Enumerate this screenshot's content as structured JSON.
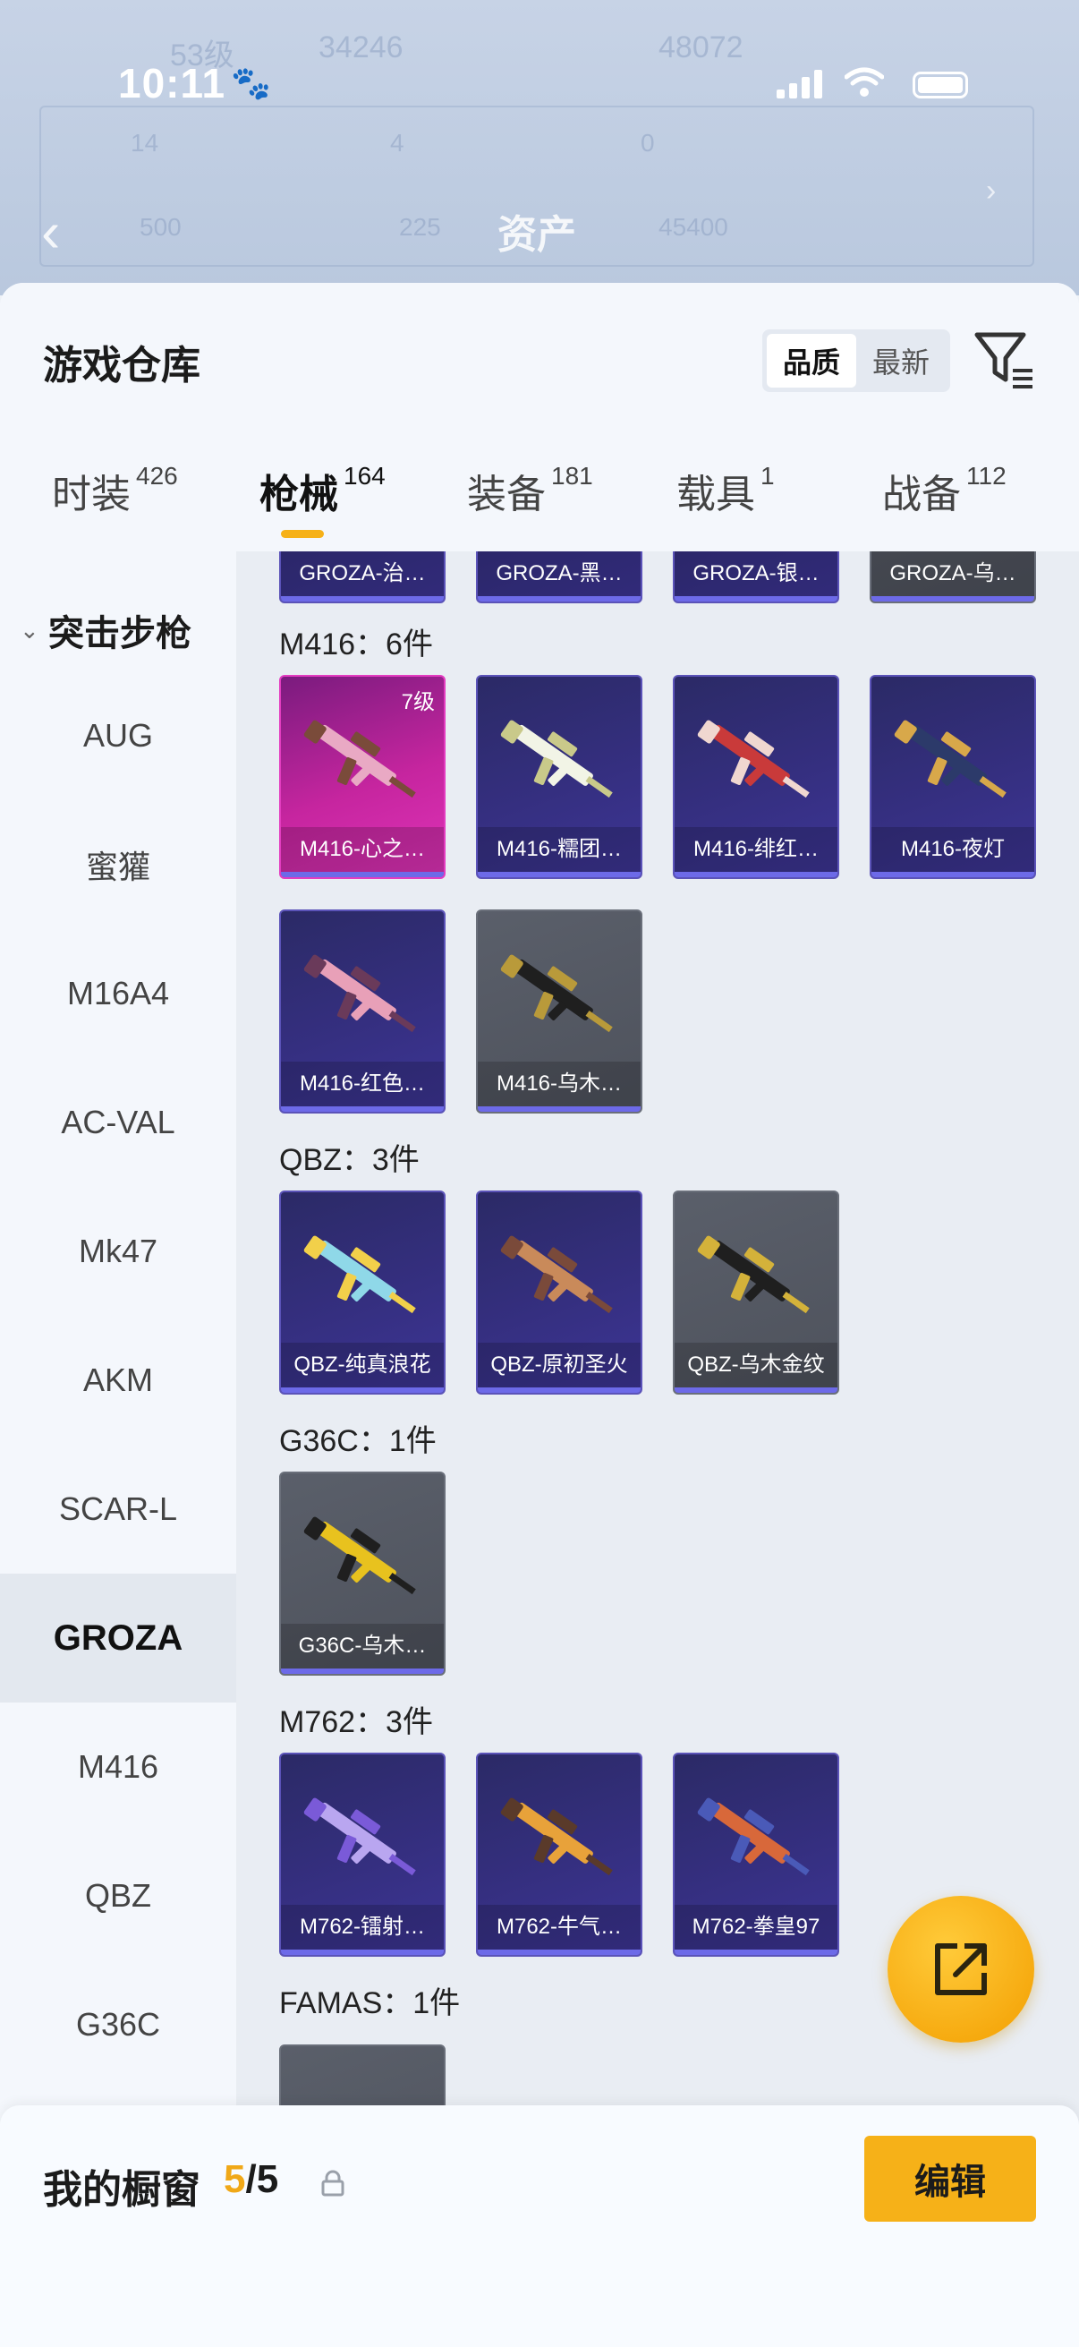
{
  "status": {
    "time": "10:11"
  },
  "background": {
    "asset_title": "资产",
    "blur_texts": [
      "53级",
      "34246",
      "48072",
      "14",
      "4",
      "0",
      "500",
      "225",
      "45400"
    ]
  },
  "sheet": {
    "title": "游戏仓库",
    "sort": {
      "options": [
        "品质",
        "最新"
      ],
      "selected": "品质"
    }
  },
  "tabs": [
    {
      "label": "时装",
      "count": "426",
      "active": false
    },
    {
      "label": "枪械",
      "count": "164",
      "active": true
    },
    {
      "label": "装备",
      "count": "181",
      "active": false
    },
    {
      "label": "载具",
      "count": "1",
      "active": false
    },
    {
      "label": "战备",
      "count": "112",
      "active": false
    }
  ],
  "sidebar": {
    "category": "突击步枪",
    "items": [
      "AUG",
      "蜜獾",
      "M16A4",
      "AC-VAL",
      "Mk47",
      "AKM",
      "SCAR-L",
      "GROZA",
      "M416",
      "QBZ",
      "G36C"
    ],
    "active_item": "GROZA"
  },
  "groups": [
    {
      "title": "M416：6件",
      "items": [
        {
          "name": "M416-心之…",
          "level": "7级",
          "rarity": "pink",
          "colors": [
            "#e9a9c4",
            "#7a4b3a"
          ]
        },
        {
          "name": "M416-糯团…",
          "rarity": "purple",
          "colors": [
            "#f2f4e6",
            "#c9c98a"
          ]
        },
        {
          "name": "M416-绯红…",
          "rarity": "purple",
          "colors": [
            "#c93a3a",
            "#f0d7d0"
          ]
        },
        {
          "name": "M416-夜灯",
          "rarity": "purple",
          "colors": [
            "#2c3a6a",
            "#d8a84a"
          ]
        },
        {
          "name": "M416-红色…",
          "rarity": "purple",
          "colors": [
            "#e8a0b8",
            "#6a3a5a"
          ]
        },
        {
          "name": "M416-乌木…",
          "rarity": "gray",
          "colors": [
            "#1f1f1f",
            "#b99a3a"
          ]
        }
      ]
    },
    {
      "title": "QBZ：3件",
      "items": [
        {
          "name": "QBZ-纯真浪花",
          "rarity": "purple",
          "colors": [
            "#8fd8e8",
            "#f2d04a"
          ]
        },
        {
          "name": "QBZ-原初圣火",
          "rarity": "purple",
          "colors": [
            "#c98a5a",
            "#7a4a3a"
          ]
        },
        {
          "name": "QBZ-乌木金纹",
          "rarity": "gray",
          "colors": [
            "#1f1f1f",
            "#d4b23a"
          ]
        }
      ]
    },
    {
      "title": "G36C：1件",
      "items": [
        {
          "name": "G36C-乌木…",
          "rarity": "gray",
          "colors": [
            "#e8c21e",
            "#1f1f1f"
          ]
        }
      ]
    },
    {
      "title": "M762：3件",
      "items": [
        {
          "name": "M762-镭射…",
          "rarity": "purple",
          "colors": [
            "#b9a6f0",
            "#7a5ad8"
          ]
        },
        {
          "name": "M762-牛气…",
          "rarity": "purple",
          "colors": [
            "#e8a23a",
            "#5a3a2a"
          ]
        },
        {
          "name": "M762-拳皇97",
          "rarity": "purple",
          "colors": [
            "#d8683a",
            "#4a5ab8"
          ]
        }
      ]
    },
    {
      "title": "FAMAS：1件",
      "items": []
    }
  ],
  "top_partial_row": [
    {
      "name": "GROZA-治…",
      "rarity": "purple"
    },
    {
      "name": "GROZA-黑…",
      "rarity": "purple"
    },
    {
      "name": "GROZA-银…",
      "rarity": "purple"
    },
    {
      "name": "GROZA-乌…",
      "rarity": "gray"
    }
  ],
  "showcase": {
    "title": "我的橱窗",
    "current": "5",
    "separator": "/",
    "total": "5",
    "edit_label": "编辑"
  }
}
